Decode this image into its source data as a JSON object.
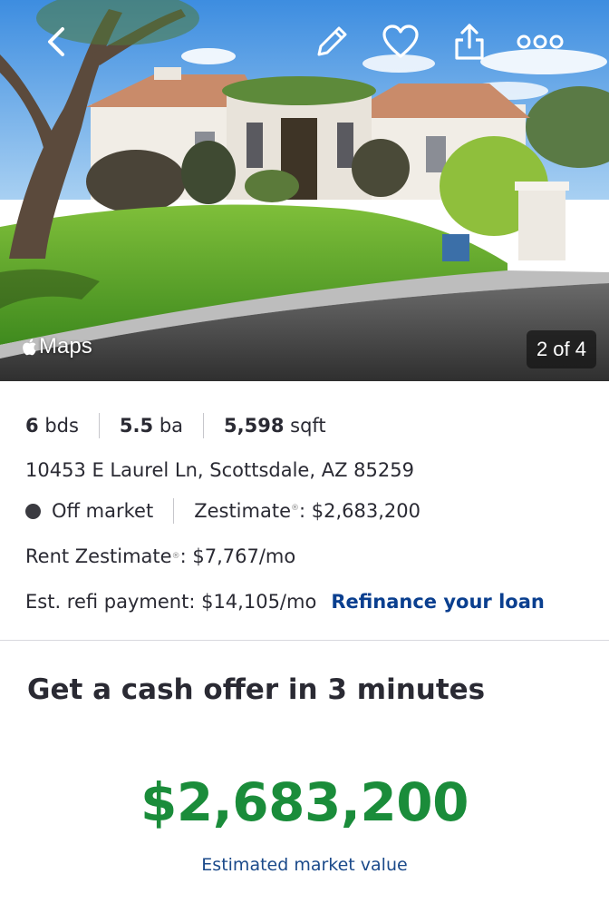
{
  "hero": {
    "maps_logo": "Maps",
    "counter": "2 of 4"
  },
  "icons": {
    "back": "chevron-left-icon",
    "edit": "pencil-icon",
    "save": "heart-icon",
    "share": "share-icon",
    "more": "more-dots-icon",
    "apple": "apple-logo-icon"
  },
  "facts": {
    "beds_num": "6",
    "beds_unit": "bds",
    "baths_num": "5.5",
    "baths_unit": "ba",
    "sqft_num": "5,598",
    "sqft_unit": "sqft",
    "address": "10453 E Laurel Ln, Scottsdale, AZ 85259",
    "status": "Off market",
    "zestimate_label": "Zestimate",
    "zestimate_value": ": $2,683,200",
    "rent_label": "Rent Zestimate",
    "rent_value": ": $7,767/mo",
    "refi_text": "Est. refi payment: $14,105/mo",
    "refi_link": "Refinance your loan",
    "reg_mark": "®"
  },
  "offer": {
    "heading": "Get a cash offer in 3 minutes",
    "value": "$2,683,200",
    "label": "Estimated market value"
  },
  "colors": {
    "accent_link": "#0a3f8f",
    "value_green": "#1a8c3a",
    "status_dot": "#3a3a40"
  }
}
